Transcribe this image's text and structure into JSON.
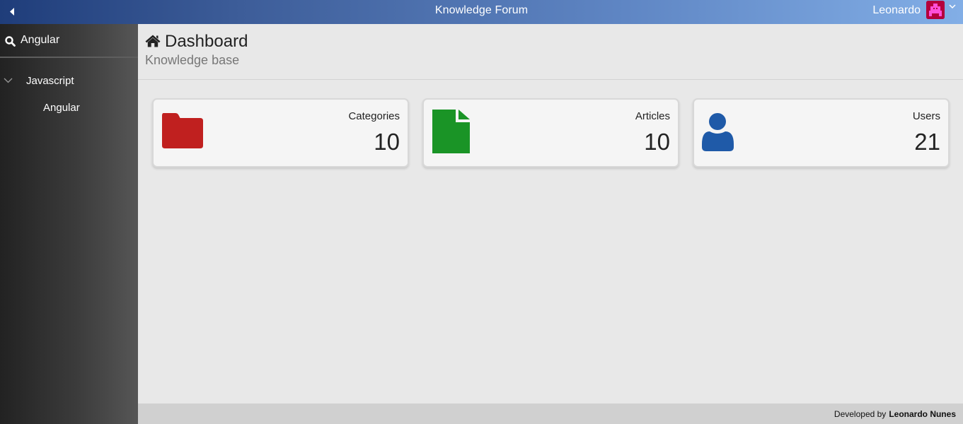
{
  "header": {
    "title": "Knowledge Forum",
    "user_name": "Leonardo",
    "toggle_icon": "caret-left-icon",
    "avatar_icon": "pixel-avatar-icon",
    "menu_icon": "chevron-down-icon",
    "gradient_colors": [
      "#1f3d7a",
      "#82aee6"
    ]
  },
  "sidebar": {
    "search": {
      "value": "Angular",
      "placeholder": "",
      "icon": "search-icon"
    },
    "tree": [
      {
        "label": "Javascript",
        "expanded": true,
        "children": [
          {
            "label": "Angular"
          }
        ]
      }
    ]
  },
  "page": {
    "icon": "home-icon",
    "title": "Dashboard",
    "subtitle": "Knowledge base"
  },
  "stats": [
    {
      "label": "Categories",
      "value": "10",
      "icon": "folder-icon",
      "color": "#c0201f"
    },
    {
      "label": "Articles",
      "value": "10",
      "icon": "file-icon",
      "color": "#1a9426"
    },
    {
      "label": "Users",
      "value": "21",
      "icon": "user-icon",
      "color": "#1f5aa8"
    }
  ],
  "footer": {
    "text": "Developed by",
    "author": "Leonardo Nunes"
  }
}
